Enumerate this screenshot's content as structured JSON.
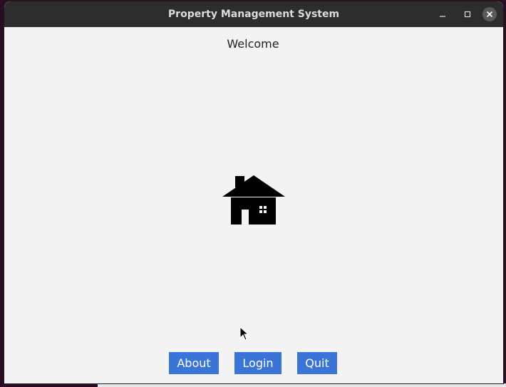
{
  "window": {
    "title": "Property Management System"
  },
  "main": {
    "welcome_text": "Welcome",
    "logo_icon": "house-icon"
  },
  "buttons": {
    "about": "About",
    "login": "Login",
    "quit": "Quit"
  },
  "colors": {
    "button_bg": "#3a74d7",
    "titlebar_bg": "#2d2d2d",
    "content_bg": "#f3f3f3"
  }
}
